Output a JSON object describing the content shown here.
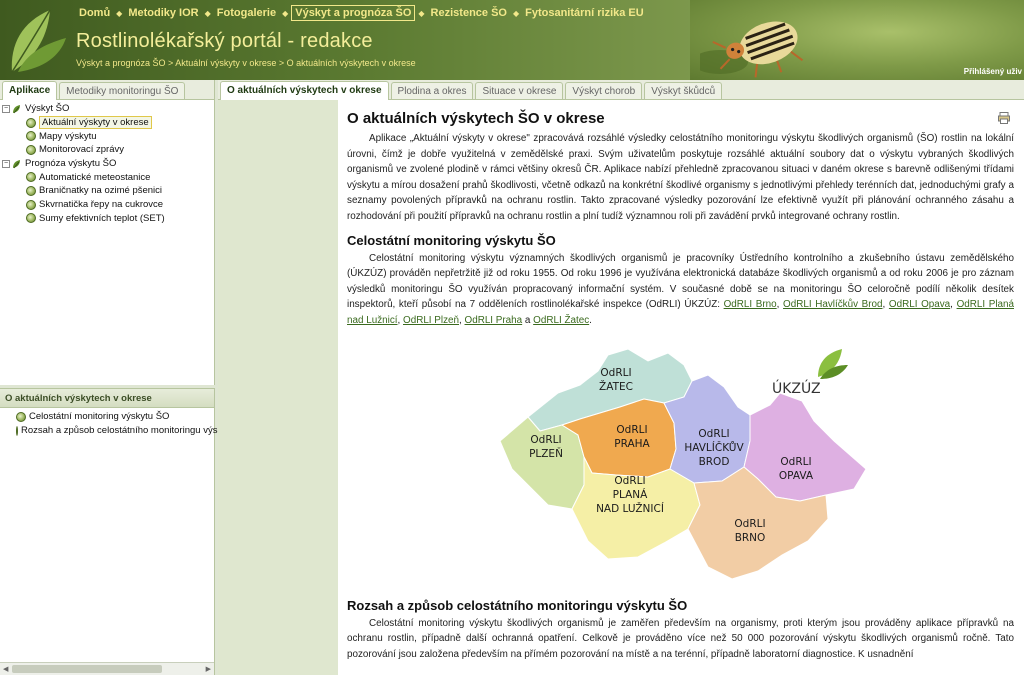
{
  "header": {
    "nav": [
      {
        "label": "Domů",
        "active": false
      },
      {
        "label": "Metodiky IOR",
        "active": false
      },
      {
        "label": "Fotogalerie",
        "active": false
      },
      {
        "label": "Výskyt a prognóza ŠO",
        "active": true
      },
      {
        "label": "Rezistence ŠO",
        "active": false
      },
      {
        "label": "Fytosanitární rizika EU",
        "active": false
      }
    ],
    "title": "Rostlinolékařský portál - redakce",
    "breadcrumb": "Výskyt a prognóza ŠO > Aktuální výskyty v okrese > O aktuálních výskytech v okrese",
    "login_label": "Přihlášený uživ"
  },
  "left_tabs": [
    "Aplikace",
    "Metodiky monitoringu ŠO"
  ],
  "app_tree": [
    {
      "label": "Výskyt ŠO",
      "level": 0,
      "selected": false
    },
    {
      "label": "Aktuální výskyty v okrese",
      "level": 1,
      "selected": true
    },
    {
      "label": "Mapy výskytu",
      "level": 1,
      "selected": false
    },
    {
      "label": "Monitorovací zprávy",
      "level": 1,
      "selected": false
    },
    {
      "label": "Prognóza výskytu ŠO",
      "level": 0,
      "selected": false
    },
    {
      "label": "Automatické meteostanice",
      "level": 1,
      "selected": false
    },
    {
      "label": "Braničnatky na ozimé pšenici",
      "level": 1,
      "selected": false
    },
    {
      "label": "Skvrnatička řepy na cukrovce",
      "level": 1,
      "selected": false
    },
    {
      "label": "Sumy efektivních teplot (SET)",
      "level": 1,
      "selected": false
    }
  ],
  "bottom_panel": {
    "title": "O aktuálních výskytech v okrese",
    "items": [
      "Celostátní monitoring výskytu ŠO",
      "Rozsah a způsob celostátního monitoringu výs"
    ]
  },
  "right_tabs": [
    {
      "label": "O aktuálních výskytech v okrese",
      "active": true
    },
    {
      "label": "Plodina a okres",
      "active": false
    },
    {
      "label": "Situace v okrese",
      "active": false
    },
    {
      "label": "Výskyt chorob",
      "active": false
    },
    {
      "label": "Výskyt škůdců",
      "active": false
    }
  ],
  "content": {
    "h1": "O aktuálních výskytech ŠO v okrese",
    "p1": "Aplikace „Aktuální výskyty v okrese\" zpracovává rozsáhlé výsledky celostátního monitoringu výskytu škodlivých organismů (ŠO) rostlin na lokální úrovni, čímž je dobře využitelná v zemědělské praxi. Svým uživatelům poskytuje rozsáhlé aktuální soubory dat o výskytu vybraných škodlivých organismů ve zvolené plodině v rámci většiny okresů ČR. Aplikace nabízí přehledně zpracovanou situaci v daném okrese s barevně odlišenými třídami výskytu a mírou dosažení prahů škodlivosti, včetně odkazů na konkrétní škodlivé organismy s jednotlivými přehledy terénních dat, jednoduchými grafy a seznamy povolených přípravků na ochranu rostlin. Takto zpracované výsledky pozorování lze efektivně využít při plánování ochranného zásahu a rozhodování při použití přípravků na ochranu rostlin a plní tudíž významnou roli při zavádění prvků integrované ochrany rostlin.",
    "h2a": "Celostátní monitoring výskytu ŠO",
    "p2": "Celostátní monitoring výskytu významných škodlivých organismů je pracovníky Ústředního kontrolního a zkušebního ústavu zemědělského (ÚKZÚZ) prováděn nepřetržitě již od roku 1955. Od roku 1996 je využívána elektronická databáze škodlivých organismů a od roku 2006 je pro záznam výsledků monitoringu ŠO využíván propracovaný informační systém. V současné době se na monitoringu ŠO celoročně podílí několik desítek inspektorů, kteří působí na 7 odděleních rostlinolékařské inspekce (OdRLI) ÚKZÚZ:",
    "links": [
      "OdRLI Brno",
      "OdRLI Havlíčkův Brod",
      "OdRLI Opava",
      "OdRLI Planá nad Lužnicí",
      "OdRLI Plzeň",
      "OdRLI Praha",
      "OdRLI Žatec"
    ],
    "sep": ",",
    "and_word": "a",
    "period": ".",
    "map": {
      "brand": "ÚKZÚZ",
      "regions": [
        {
          "line1": "OdRLI",
          "line2": "ŽATEC",
          "line3": ""
        },
        {
          "line1": "OdRLI",
          "line2": "PRAHA",
          "line3": ""
        },
        {
          "line1": "OdRLI",
          "line2": "PLZEŇ",
          "line3": ""
        },
        {
          "line1": "OdRLI",
          "line2": "HAVLÍČKŮV",
          "line3": "BROD"
        },
        {
          "line1": "OdRLI",
          "line2": "OPAVA",
          "line3": ""
        },
        {
          "line1": "OdRLI",
          "line2": "PLANÁ",
          "line3": "NAD LUŽNICÍ"
        },
        {
          "line1": "OdRLI",
          "line2": "BRNO",
          "line3": ""
        }
      ]
    },
    "h2b": "Rozsah a způsob celostátního monitoringu výskytu ŠO",
    "p3": "Celostátní monitoring výskytu škodlivých organismů je zaměřen především na organismy, proti kterým jsou prováděny aplikace přípravků na ochranu rostlin, případně další ochranná opatření. Celkově je prováděno více než 50 000 pozorování výskytu škodlivých organismů ročně. Tato pozorování jsou založena především na přímém pozorování na místě a na terénní, případně laboratorní diagnostice. K usnadnění"
  },
  "colors": {
    "zatec": "#bfe0d7",
    "praha": "#f0a94f",
    "plzen": "#d4e4a8",
    "havlickuv_brod": "#b8b9ea",
    "opava": "#deb0e2",
    "plana": "#f5efa6",
    "brno": "#f2cda5"
  }
}
